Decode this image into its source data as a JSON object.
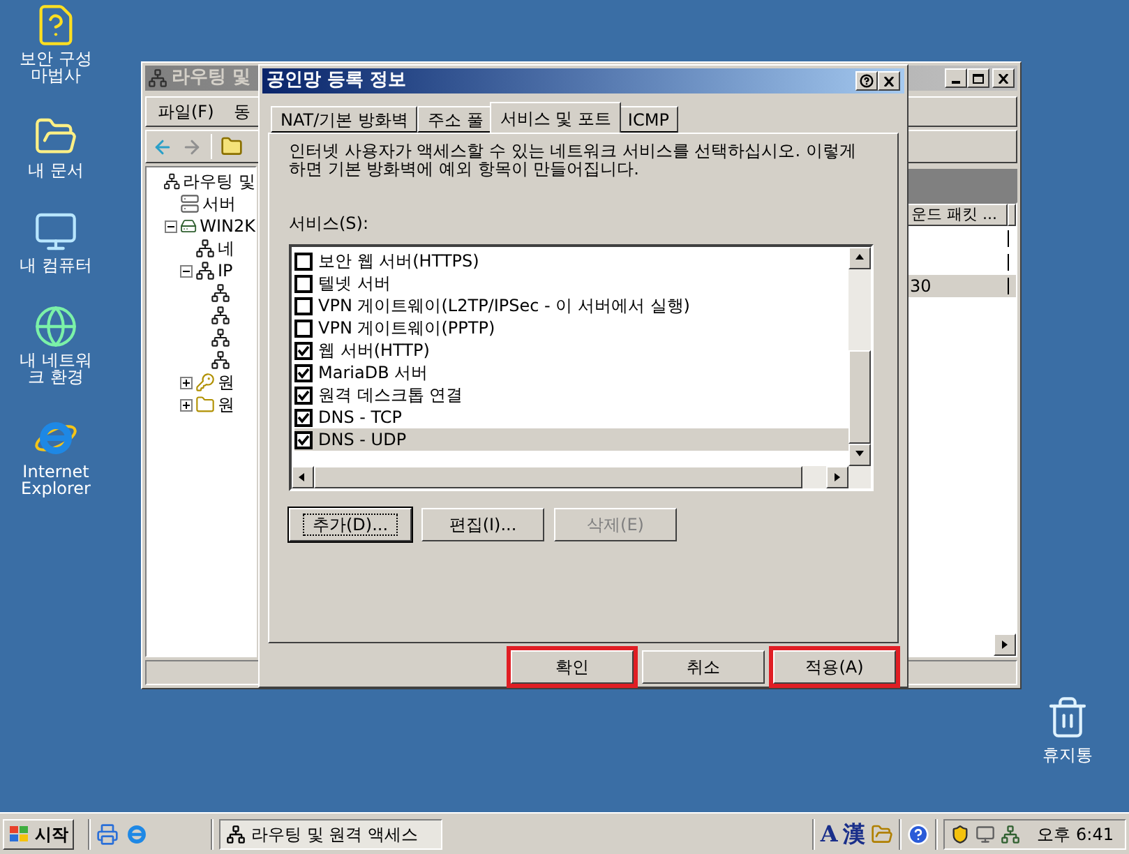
{
  "desktop_icons": [
    {
      "kind": "wizard",
      "label": "보안 구성 마법사"
    },
    {
      "kind": "documents",
      "label": "내 문서"
    },
    {
      "kind": "computer",
      "label": "내 컴퓨터"
    },
    {
      "kind": "network",
      "label": "내 네트워크 환경"
    },
    {
      "kind": "browser",
      "label": "Internet Explorer"
    }
  ],
  "recycle_bin": {
    "label": "휴지통"
  },
  "main_window": {
    "title": "라우팅 및",
    "menu": [
      "파일(F)",
      "동"
    ],
    "tree": [
      {
        "kind": "router",
        "label": "라우팅 및",
        "children": [
          {
            "kind": "servers",
            "label": "서버"
          },
          {
            "kind": "server",
            "label": "WIN2K",
            "expanded": true,
            "children": [
              {
                "kind": "router",
                "label": "네"
              },
              {
                "kind": "router",
                "label": "IP",
                "expanded": true,
                "children": [
                  {
                    "kind": "router"
                  },
                  {
                    "kind": "router"
                  },
                  {
                    "kind": "router"
                  },
                  {
                    "kind": "router"
                  }
                ]
              },
              {
                "kind": "policy",
                "label": "원",
                "expanded": false
              },
              {
                "kind": "folder",
                "label": "원",
                "expanded": false
              }
            ]
          }
        ]
      }
    ],
    "list": {
      "columns": [
        "운드 패킷 ..."
      ],
      "rows": [
        {
          "selected": false
        },
        {
          "selected": false
        },
        {
          "selected": true,
          "column_1": "30"
        }
      ]
    }
  },
  "dialog": {
    "title": "공인망 등록 정보",
    "tabs": [
      {
        "label": "NAT/기본 방화벽",
        "selected": false
      },
      {
        "label": "주소 풀",
        "selected": false
      },
      {
        "label": "서비스 및 포트",
        "selected": true
      },
      {
        "label": "ICMP",
        "selected": false
      }
    ],
    "description": "인터넷 사용자가 액세스할 수 있는 네트워크 서비스를 선택하십시오. 이렇게 하면 기본 방화벽에 예외 항목이 만들어집니다.",
    "services_label": "서비스(S):",
    "services": [
      {
        "label": "보안 웹 서버(HTTPS)",
        "checked": false,
        "selected": false
      },
      {
        "label": "텔넷 서버",
        "checked": false,
        "selected": false
      },
      {
        "label": "VPN 게이트웨이(L2TP/IPSec - 이 서버에서 실행)",
        "checked": false,
        "selected": false
      },
      {
        "label": "VPN 게이트웨이(PPTP)",
        "checked": false,
        "selected": false
      },
      {
        "label": "웹 서버(HTTP)",
        "checked": true,
        "selected": false
      },
      {
        "label": "MariaDB 서버",
        "checked": true,
        "selected": false
      },
      {
        "label": "원격 데스크톱 연결",
        "checked": true,
        "selected": false
      },
      {
        "label": "DNS - TCP",
        "checked": true,
        "selected": false
      },
      {
        "label": "DNS - UDP",
        "checked": true,
        "selected": true
      }
    ],
    "list_buttons": [
      {
        "label": "추가(D)...",
        "disabled": false,
        "focused": true
      },
      {
        "label": "편집(I)...",
        "disabled": false,
        "focused": false
      },
      {
        "label": "삭제(E)",
        "disabled": true,
        "focused": false
      }
    ],
    "buttons": [
      {
        "label": "확인",
        "highlighted": true
      },
      {
        "label": "취소",
        "highlighted": false
      },
      {
        "label": "적용(A)",
        "highlighted": true
      }
    ]
  },
  "taskbar": {
    "start": "시작",
    "tasks": [
      {
        "label": "라우팅 및 원격 액세스"
      }
    ],
    "language": "A",
    "ime": "漢",
    "clock": "오후 6:41"
  }
}
